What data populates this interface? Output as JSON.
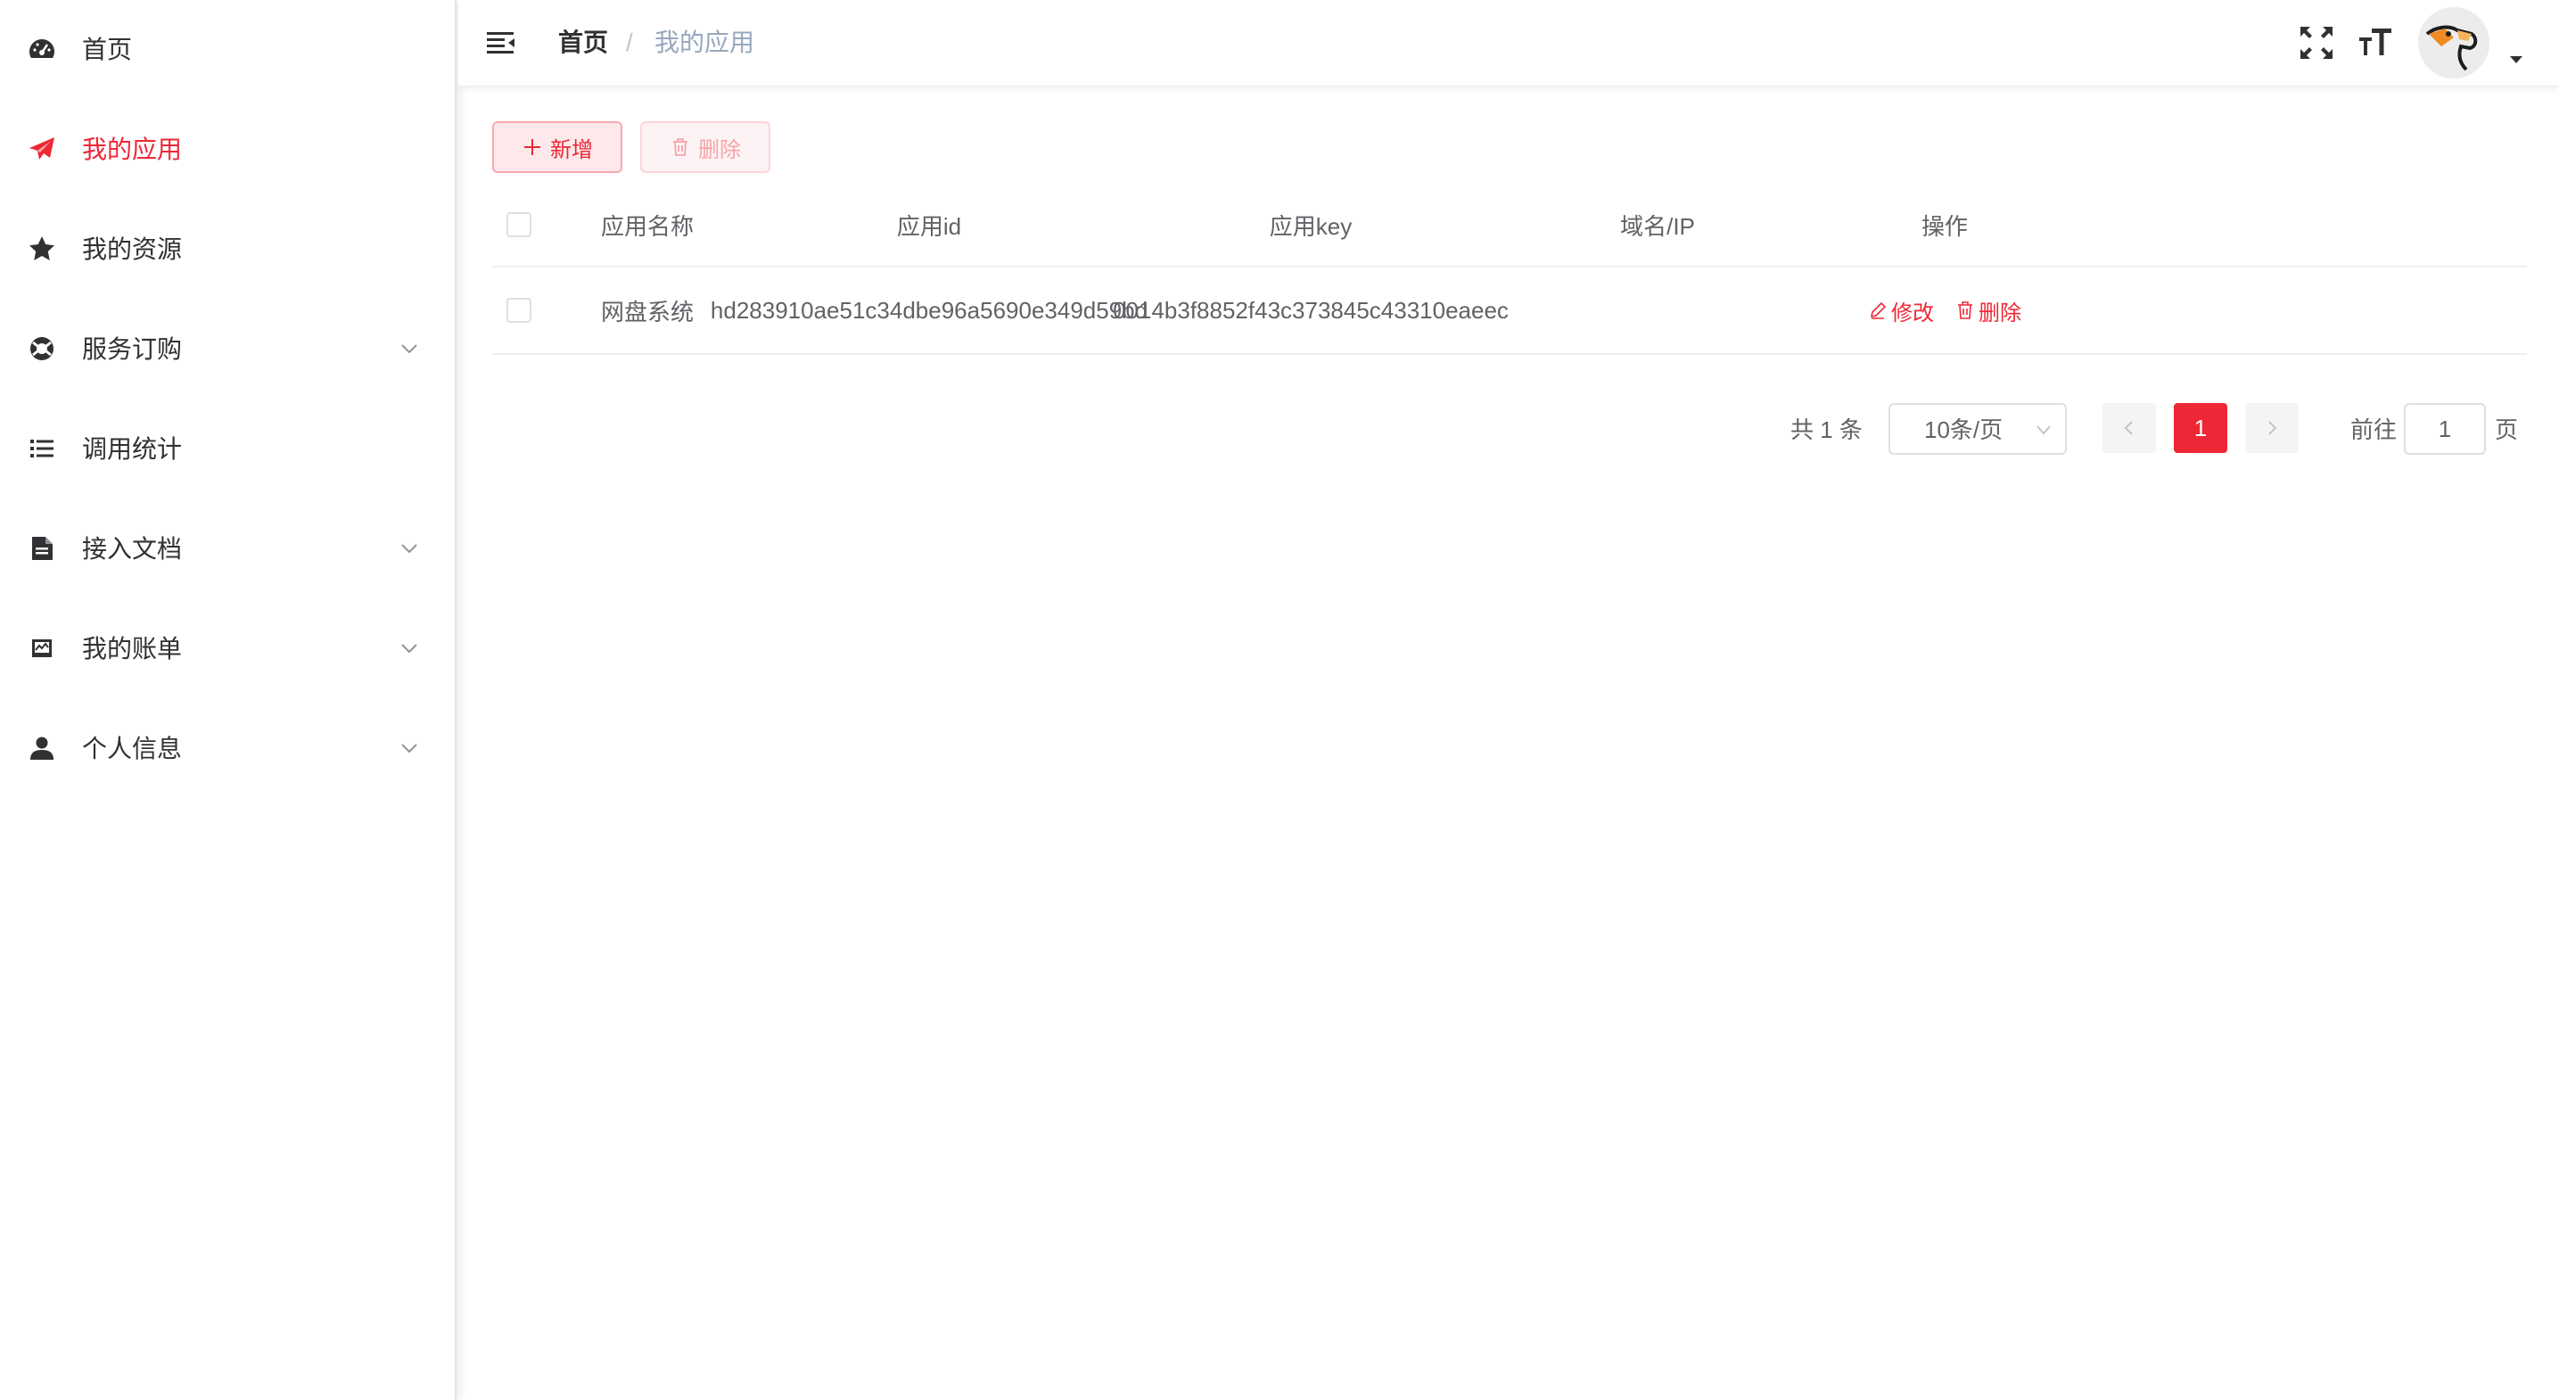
{
  "sidebar": {
    "items": [
      {
        "label": "首页",
        "icon": "dashboard-icon",
        "expandable": false,
        "active": false
      },
      {
        "label": "我的应用",
        "icon": "send-icon",
        "expandable": false,
        "active": true
      },
      {
        "label": "我的资源",
        "icon": "star-icon",
        "expandable": false,
        "active": false
      },
      {
        "label": "服务订购",
        "icon": "lifebuoy-icon",
        "expandable": true,
        "active": false
      },
      {
        "label": "调用统计",
        "icon": "list-icon",
        "expandable": false,
        "active": false
      },
      {
        "label": "接入文档",
        "icon": "document-icon",
        "expandable": true,
        "active": false
      },
      {
        "label": "我的账单",
        "icon": "bill-icon",
        "expandable": true,
        "active": false
      },
      {
        "label": "个人信息",
        "icon": "user-icon",
        "expandable": true,
        "active": false
      }
    ]
  },
  "header": {
    "breadcrumb": {
      "home": "首页",
      "separator": "/",
      "current": "我的应用"
    }
  },
  "toolbar": {
    "add_label": "新增",
    "delete_label": "删除"
  },
  "table": {
    "columns": [
      "应用名称",
      "应用id",
      "应用key",
      "域名/IP",
      "操作"
    ],
    "rows": [
      {
        "name": "网盘系统",
        "app_id": "hd283910ae51c34dbe96a5690e349d59bd",
        "app_key": "0014b3f8852f43c373845c43310eaeec",
        "domain": "",
        "edit_label": "修改",
        "delete_label": "删除"
      }
    ]
  },
  "pagination": {
    "total_text": "共 1 条",
    "page_size": "10条/页",
    "current_page": "1",
    "goto_label": "前往",
    "goto_value": "1",
    "page_unit": "页"
  },
  "colors": {
    "accent": "#ee2736",
    "text": "#303133",
    "muted": "#606266"
  }
}
